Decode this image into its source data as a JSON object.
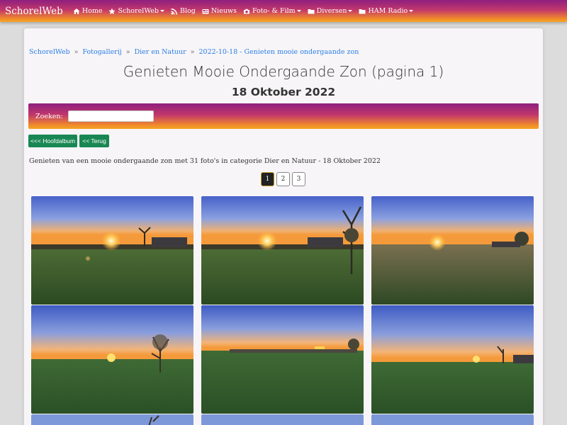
{
  "navbar": {
    "brand": "SchorelWeb",
    "items": [
      {
        "label": "Home",
        "icon": "home-icon",
        "dropdown": false
      },
      {
        "label": "SchorelWeb",
        "icon": "star-icon",
        "dropdown": true
      },
      {
        "label": "Blog",
        "icon": "rss-icon",
        "dropdown": false
      },
      {
        "label": "Nieuws",
        "icon": "newspaper-icon",
        "dropdown": false
      },
      {
        "label": "Foto- & Film",
        "icon": "camera-icon",
        "dropdown": true
      },
      {
        "label": "Diversen",
        "icon": "folder-icon",
        "dropdown": true
      },
      {
        "label": "HAM Radio",
        "icon": "folder-icon",
        "dropdown": true
      }
    ]
  },
  "breadcrumb": [
    "SchorelWeb",
    "Fotogallerij",
    "Dier en Natuur",
    "2022-10-18 - Genieten mooie ondergaande zon"
  ],
  "breadcrumb_separator": "»",
  "page": {
    "title": "Genieten Mooie Ondergaande Zon (pagina 1)",
    "subtitle": "18 Oktober 2022",
    "description": "Genieten van een mooie ondergaande zon met 31 foto's in categorie Dier en Natuur - 18 Oktober 2022"
  },
  "search": {
    "label": "Zoeken:",
    "value": ""
  },
  "buttons": {
    "main_album": "<<< Hoofdalbum",
    "back": "<< Terug"
  },
  "pagination": {
    "pages": [
      "1",
      "2",
      "3"
    ],
    "active": "1"
  },
  "colors": {
    "gradient_top": "#8e1f7f",
    "gradient_bottom": "#f5a623",
    "button_green": "#198754",
    "link_blue": "#2a7ee8"
  }
}
